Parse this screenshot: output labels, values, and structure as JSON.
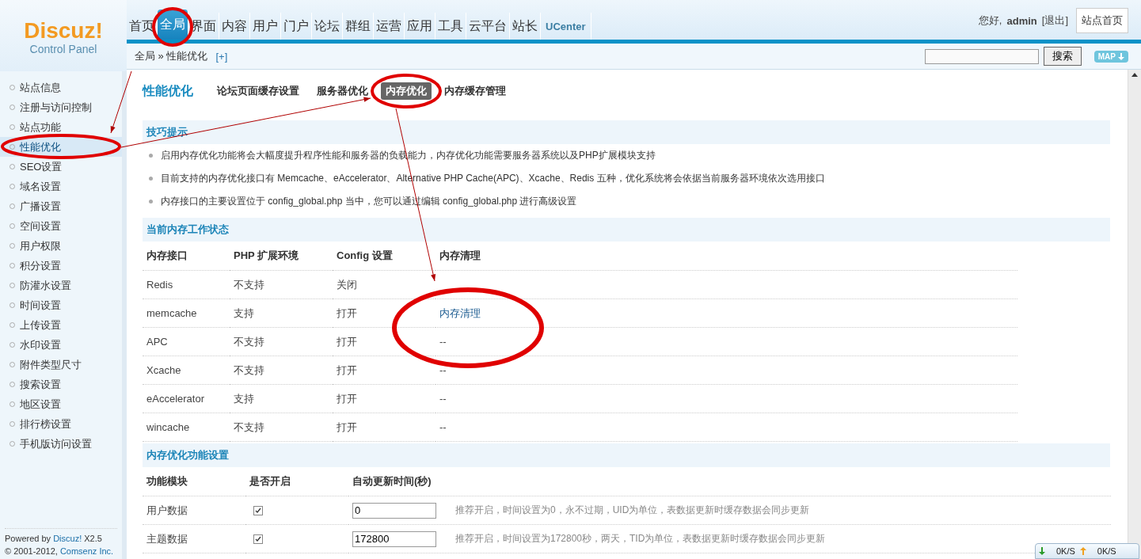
{
  "logo": {
    "name": "Discuz!",
    "subtitle": "Control Panel"
  },
  "nav": [
    {
      "label": "首页",
      "selected": false
    },
    {
      "label": "全局",
      "selected": true
    },
    {
      "label": "界面",
      "selected": false
    },
    {
      "label": "内容",
      "selected": false
    },
    {
      "label": "用户",
      "selected": false
    },
    {
      "label": "门户",
      "selected": false
    },
    {
      "label": "论坛",
      "selected": false
    },
    {
      "label": "群组",
      "selected": false
    },
    {
      "label": "运营",
      "selected": false
    },
    {
      "label": "应用",
      "selected": false
    },
    {
      "label": "工具",
      "selected": false
    },
    {
      "label": "云平台",
      "selected": false
    },
    {
      "label": "站长",
      "selected": false
    },
    {
      "label": "UCenter",
      "selected": false
    }
  ],
  "user": {
    "greeting": "您好,",
    "name": "admin",
    "logout": "[退出]",
    "site_home": "站点首页"
  },
  "breadcrumb": {
    "path": "全局 » 性能优化",
    "add": "[+]",
    "search_button": "搜索",
    "map_button": "MAP"
  },
  "sidebar": {
    "items": [
      {
        "label": "站点信息",
        "selected": false
      },
      {
        "label": "注册与访问控制",
        "selected": false
      },
      {
        "label": "站点功能",
        "selected": false
      },
      {
        "label": "性能优化",
        "selected": true
      },
      {
        "label": "SEO设置",
        "selected": false
      },
      {
        "label": "域名设置",
        "selected": false
      },
      {
        "label": "广播设置",
        "selected": false
      },
      {
        "label": "空间设置",
        "selected": false
      },
      {
        "label": "用户权限",
        "selected": false
      },
      {
        "label": "积分设置",
        "selected": false
      },
      {
        "label": "防灌水设置",
        "selected": false
      },
      {
        "label": "时间设置",
        "selected": false
      },
      {
        "label": "上传设置",
        "selected": false
      },
      {
        "label": "水印设置",
        "selected": false
      },
      {
        "label": "附件类型尺寸",
        "selected": false
      },
      {
        "label": "搜索设置",
        "selected": false
      },
      {
        "label": "地区设置",
        "selected": false
      },
      {
        "label": "排行榜设置",
        "selected": false
      },
      {
        "label": "手机版访问设置",
        "selected": false
      }
    ],
    "footer": {
      "powered": "Powered by",
      "brand": "Discuz!",
      "version": "X2.5",
      "copyright": "© 2001-2012,",
      "company": "Comsenz Inc."
    }
  },
  "page": {
    "title": "性能优化",
    "tabs": [
      {
        "label": "论坛页面缓存设置",
        "selected": false
      },
      {
        "label": "服务器优化",
        "selected": false
      },
      {
        "label": "内存优化",
        "selected": true
      },
      {
        "label": "内存缓存管理",
        "selected": false
      }
    ],
    "tips": {
      "header": "技巧提示",
      "items": [
        "启用内存优化功能将会大幅度提升程序性能和服务器的负载能力，内存优化功能需要服务器系统以及PHP扩展模块支持",
        "目前支持的内存优化接口有 Memcache、eAccelerator、Alternative PHP Cache(APC)、Xcache、Redis 五种，优化系统将会依据当前服务器环境依次选用接口",
        "内存接口的主要设置位于 config_global.php 当中，您可以通过编辑 config_global.php 进行高级设置"
      ]
    },
    "status": {
      "header": "当前内存工作状态",
      "columns": [
        "内存接口",
        "PHP 扩展环境",
        "Config 设置",
        "内存清理"
      ],
      "rows": [
        {
          "interface": "Redis",
          "php": "不支持",
          "config": "关闭"
        },
        {
          "interface": "memcache",
          "php": "支持",
          "config": "打开",
          "clear": {
            "kind": "link",
            "text": "内存清理"
          }
        },
        {
          "interface": "APC",
          "php": "不支持",
          "config": "打开",
          "clear": {
            "kind": "text",
            "text": "--"
          }
        },
        {
          "interface": "Xcache",
          "php": "不支持",
          "config": "打开",
          "clear": {
            "kind": "text",
            "text": "--"
          }
        },
        {
          "interface": "eAccelerator",
          "php": "支持",
          "config": "打开",
          "clear": {
            "kind": "text",
            "text": "--"
          }
        },
        {
          "interface": "wincache",
          "php": "不支持",
          "config": "打开",
          "clear": {
            "kind": "text",
            "text": "--"
          }
        }
      ]
    },
    "settings": {
      "header": "内存优化功能设置",
      "columns": [
        "功能模块",
        "是否开启",
        "自动更新时间(秒)"
      ],
      "rows": [
        {
          "module": "用户数据",
          "checked": true,
          "value": "0",
          "note": "推荐开启，时间设置为0，永不过期，UID为单位，表数据更新时缓存数据会同步更新"
        },
        {
          "module": "主题数据",
          "checked": true,
          "value": "172800",
          "note": "推荐开启，时间设置为172800秒，两天，TID为单位，表数据更新时缓存数据会同步更新"
        }
      ]
    }
  },
  "speed": {
    "down": "0K/S",
    "up": "0K/S"
  }
}
